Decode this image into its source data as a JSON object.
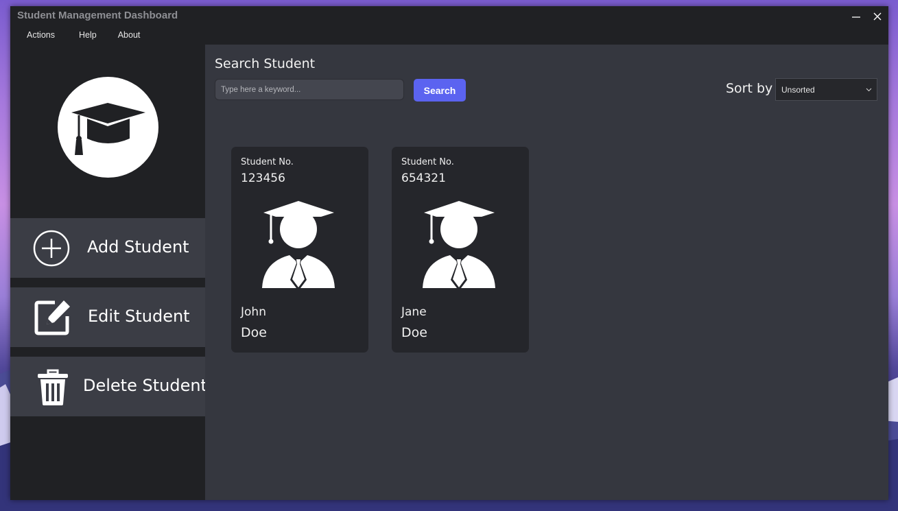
{
  "window": {
    "title": "Student Management Dashboard"
  },
  "menu": {
    "items": [
      "Actions",
      "Help",
      "About"
    ]
  },
  "sidebar": {
    "logo_icon": "graduation-cap-icon",
    "nav": [
      {
        "label": "Add Student",
        "icon": "plus-circle-icon"
      },
      {
        "label": "Edit Student",
        "icon": "edit-pencil-icon"
      },
      {
        "label": "Delete Student",
        "icon": "trash-icon"
      }
    ]
  },
  "search": {
    "heading": "Search Student",
    "placeholder": "Type here a keyword...",
    "value": "",
    "button_label": "Search"
  },
  "sort": {
    "label": "Sort by",
    "selected": "Unsorted"
  },
  "students": [
    {
      "no_label": "Student No.",
      "number": "123456",
      "first_name": "John",
      "last_name": "Doe"
    },
    {
      "no_label": "Student No.",
      "number": "654321",
      "first_name": "Jane",
      "last_name": "Doe"
    }
  ],
  "colors": {
    "accent": "#5b63f0",
    "sidebar_bg": "#202124",
    "main_bg": "#35373f",
    "card_bg": "#25262b",
    "nav_button_bg": "#3b3d45"
  }
}
